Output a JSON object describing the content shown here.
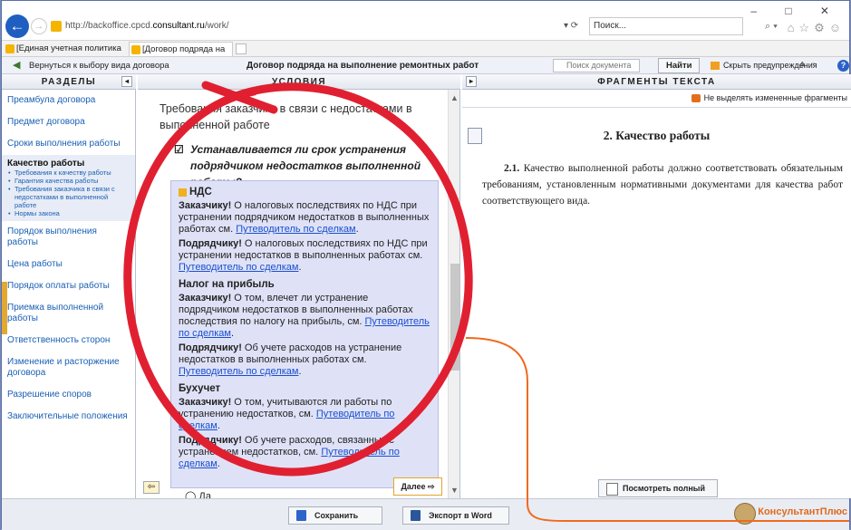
{
  "browser": {
    "url_prefix": "http://backoffice.cpcd.",
    "url_host": "consultant.ru",
    "url_path": "/work/",
    "search_placeholder": "Поиск...",
    "refresh": "▾ ⟳",
    "window_controls": "– □ ✕",
    "tabs": [
      {
        "label": "[Единая учетная политика (це..."
      },
      {
        "label": "[Договор подряда на выпо..."
      }
    ]
  },
  "toolbar": {
    "back_label": "Вернуться к выбору вида договора",
    "title": "Договор подряда на выполнение ремонтных работ",
    "doc_search_placeholder": "Поиск документа",
    "find_label": "Найти",
    "hide_warnings": "Скрыть предупреждения",
    "font_size": "A⁻ A⁺"
  },
  "columns": {
    "left": "РАЗДЕЛЫ",
    "mid": "УСЛОВИЯ",
    "right": "ФРАГМЕНТЫ ТЕКСТА"
  },
  "sidebar": {
    "items_top": [
      "Преамбула договора",
      "Предмет договора",
      "Сроки выполнения работы"
    ],
    "current": {
      "title": "Качество работы",
      "subs": [
        "Требования к качеству работы",
        "Гарантия качества работы",
        "Требования заказчика в связи с недостатками в выполненной работе",
        "Нормы закона"
      ]
    },
    "items_bottom": [
      "Порядок выполнения работы",
      "Цена работы",
      "Порядок оплаты работы",
      "Приемка выполненной работы",
      "Ответственность сторон",
      "Изменение и расторжение договора",
      "Разрешение споров",
      "Заключительные положения"
    ]
  },
  "middle": {
    "heading": "Требования заказчика в связи с недостатками в выполненной работе",
    "question": "Устанавливается ли срок устранения подрядчиком недостатков выполненной работы?",
    "blocks": [
      {
        "title": "НДС",
        "paras": [
          {
            "who": "Заказчику!",
            "text": " О налоговых последствиях по НДС при устранении подрядчиком недостатков в выполненных работах см. ",
            "link": "Путеводитель по сделкам",
            "end": "."
          },
          {
            "who": "Подрядчику!",
            "text": " О налоговых последствиях по НДС при устранении недостатков в выполненных работах см. ",
            "link": "Путеводитель по сделкам",
            "end": "."
          }
        ]
      },
      {
        "title": "Налог на прибыль",
        "paras": [
          {
            "who": "Заказчику!",
            "text": " О том, влечет ли устранение подрядчиком недостатков в выполненных работах последствия по налогу на прибыль, см. ",
            "link": "Путеводитель по сделкам",
            "end": "."
          },
          {
            "who": "Подрядчику!",
            "text": " Об учете расходов на устранение недостатков в выполненных работах см. ",
            "link": "Путеводитель по сделкам",
            "end": "."
          }
        ]
      },
      {
        "title": "Бухучет",
        "paras": [
          {
            "who": "Заказчику!",
            "text": " О том, учитываются ли работы по устранению недостатков, см. ",
            "link": "Путеводитель по сделкам",
            "end": "."
          },
          {
            "who": "Подрядчику!",
            "text": " Об учете расходов, связанных с устранением недостатков, см. ",
            "link": "Путеводитель по сделкам",
            "end": "."
          }
        ]
      }
    ],
    "next_label": "Далее ⇨",
    "prev_label": "⇦",
    "radio_yes": "Да"
  },
  "right": {
    "not_highlight": "Не выделять измененные фрагменты",
    "section_title": "2.  Качество работы",
    "para_num": "2.1.",
    "para_text": " Качество выполненной работы должно соответствовать обязательным требованиям, установленным нормативными документами для качества работ соответствующего вида.",
    "full_text_btn": "Посмотреть полный текст"
  },
  "footer": {
    "save_label": "Сохранить",
    "export_label": "Экспорт в Word",
    "brand": "КонсультантПлюс"
  },
  "colors": {
    "annotation_red": "#e02030",
    "annotation_orange": "#f06a1e",
    "panel_bg": "#dfe2f7"
  }
}
